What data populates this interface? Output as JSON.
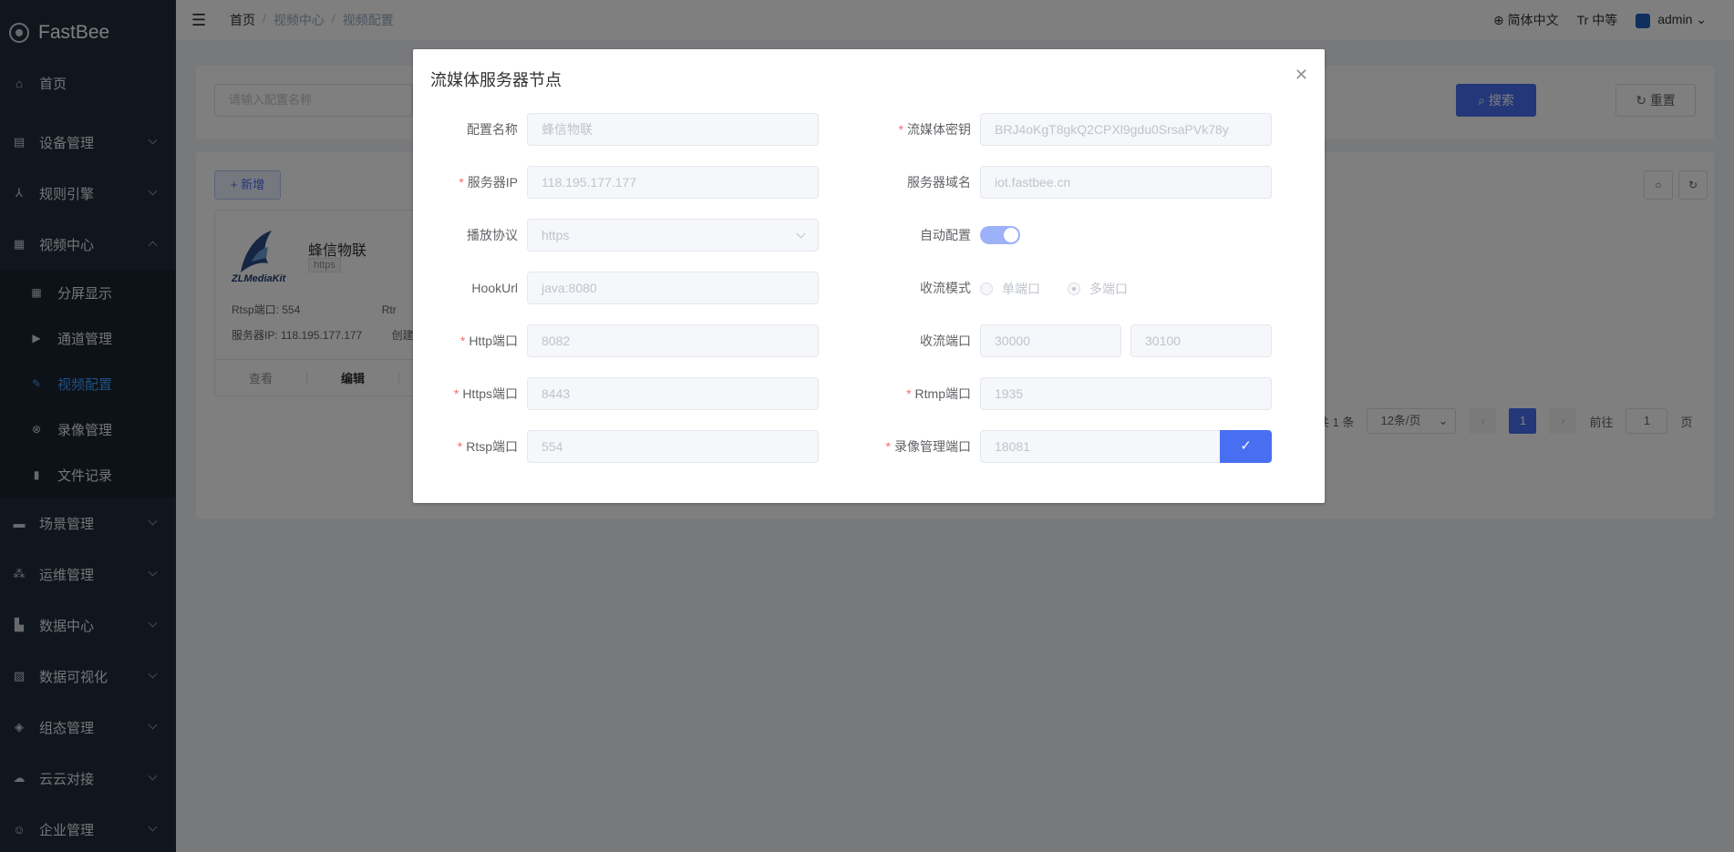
{
  "app": {
    "name": "FastBee"
  },
  "sidebar": {
    "items": [
      {
        "label": "首页",
        "icon": "home-icon"
      },
      {
        "label": "设备管理",
        "icon": "device-icon"
      },
      {
        "label": "规则引擎",
        "icon": "rule-icon"
      },
      {
        "label": "视频中心",
        "icon": "video-icon"
      },
      {
        "label": "场景管理",
        "icon": "scene-icon"
      },
      {
        "label": "运维管理",
        "icon": "ops-icon"
      },
      {
        "label": "数据中心",
        "icon": "data-icon"
      },
      {
        "label": "数据可视化",
        "icon": "visual-icon"
      },
      {
        "label": "组态管理",
        "icon": "config-icon"
      },
      {
        "label": "云云对接",
        "icon": "cloud-icon"
      },
      {
        "label": "企业管理",
        "icon": "enterprise-icon"
      }
    ],
    "video_sub": [
      {
        "label": "分屏显示",
        "icon": "split-screen-icon"
      },
      {
        "label": "通道管理",
        "icon": "channel-icon"
      },
      {
        "label": "视频配置",
        "icon": "edit-icon"
      },
      {
        "label": "录像管理",
        "icon": "record-icon"
      },
      {
        "label": "文件记录",
        "icon": "file-icon"
      }
    ]
  },
  "navbar": {
    "breadcrumb": [
      "首页",
      "视频中心",
      "视频配置"
    ],
    "language": "简体中文",
    "size": "中等",
    "user": "admin"
  },
  "search": {
    "placeholder": "请输入配置名称",
    "search_label": "搜索",
    "reset_label": "重置",
    "add_label": "新增"
  },
  "media_card": {
    "logo_text": "ZLMediaKit",
    "title": "蜂信物联",
    "tag": "https",
    "rtsp_label": "Rtsp端口:",
    "rtsp_value": "554",
    "rtmp_partial": "Rtr",
    "ip_label": "服务器IP:",
    "ip_value": "118.195.177.177",
    "created_partial": "创建",
    "actions": [
      "查看",
      "编辑",
      ""
    ]
  },
  "pagination": {
    "total": "共 1 条",
    "page_size": "12条/页",
    "current": "1",
    "goto_label": "前往",
    "goto_value": "1",
    "page_unit": "页"
  },
  "dialog": {
    "title": "流媒体服务器节点",
    "fields": {
      "config_name": {
        "label": "配置名称",
        "value": "蜂信物联"
      },
      "secret": {
        "label": "流媒体密钥",
        "value": "BRJ4oKgT8gkQ2CPXl9gdu0SrsaPVk78y"
      },
      "server_ip": {
        "label": "服务器IP",
        "value": "118.195.177.177"
      },
      "domain": {
        "label": "服务器域名",
        "value": "iot.fastbee.cn"
      },
      "protocol": {
        "label": "播放协议",
        "value": "https"
      },
      "auto_config": {
        "label": "自动配置",
        "enabled": true
      },
      "hookurl": {
        "label": "HookUrl",
        "value": "java:8080"
      },
      "stream_mode": {
        "label": "收流模式",
        "options": [
          "单端口",
          "多端口"
        ],
        "selected": "多端口"
      },
      "http_port": {
        "label": "Http端口",
        "value": "8082"
      },
      "stream_ports": {
        "label": "收流端口",
        "start": "30000",
        "end": "30100"
      },
      "https_port": {
        "label": "Https端口",
        "value": "8443"
      },
      "rtmp_port": {
        "label": "Rtmp端口",
        "value": "1935"
      },
      "rtsp_port": {
        "label": "Rtsp端口",
        "value": "554"
      },
      "record_port": {
        "label": "录像管理端口",
        "value": "18081"
      }
    }
  },
  "colors": {
    "sidebar": "#1f2d3d",
    "primary": "#486ff2",
    "active": "#409eff"
  }
}
